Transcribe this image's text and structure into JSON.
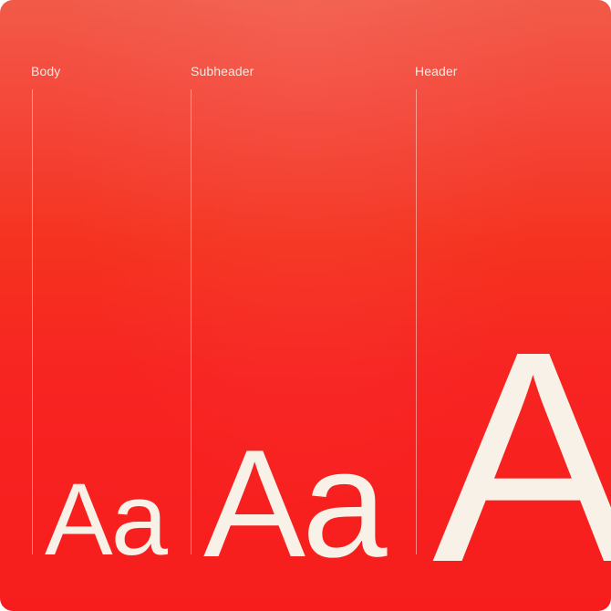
{
  "columns": [
    {
      "label": "Body",
      "sample": "Aa"
    },
    {
      "label": "Subheader",
      "sample": "Aa"
    },
    {
      "label": "Header",
      "sample": "A"
    }
  ],
  "colors": {
    "background_top": "#f25a48",
    "background_bottom": "#f71d1d",
    "text": "#f7f1e7",
    "label": "#fbe7e0"
  }
}
